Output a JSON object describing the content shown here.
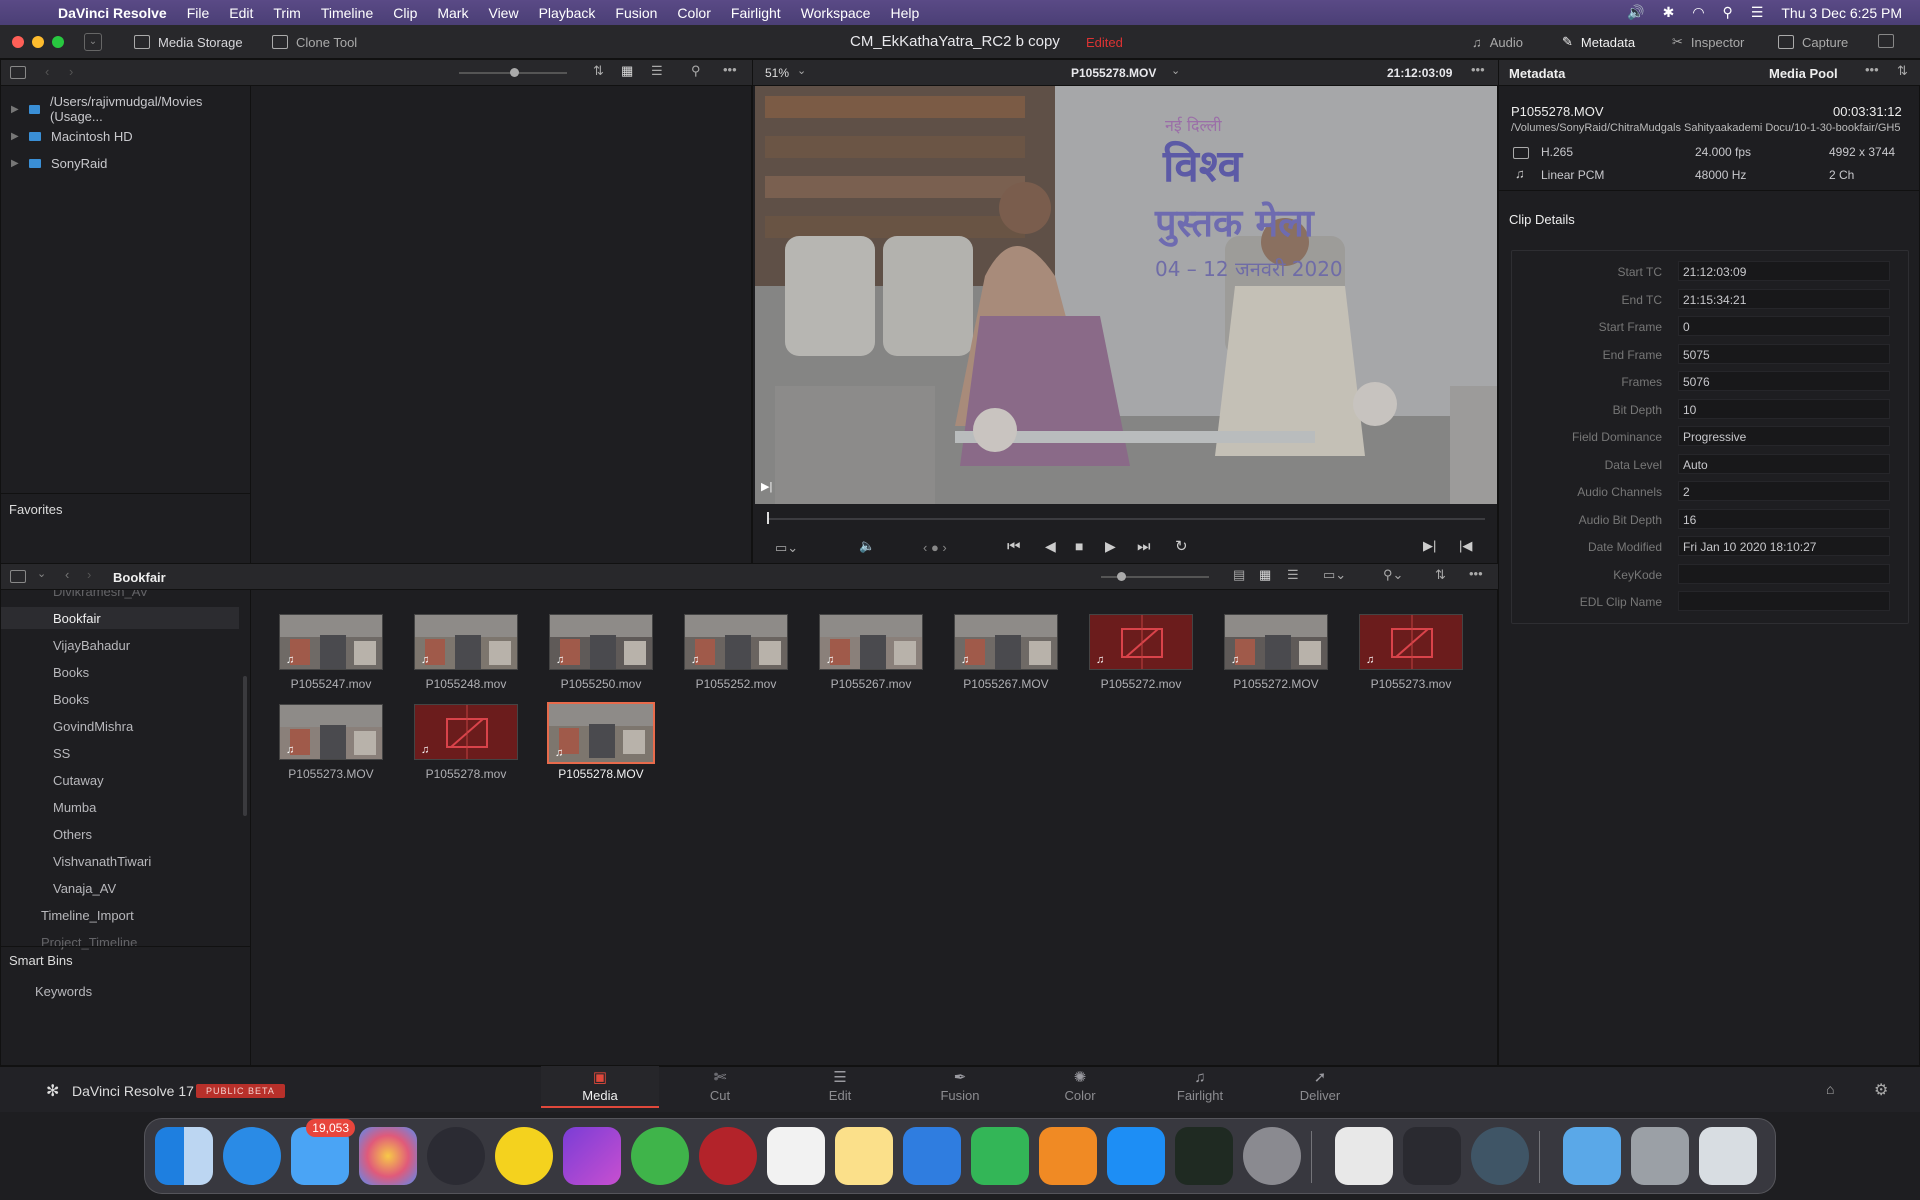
{
  "menubar": {
    "app_name": "DaVinci Resolve",
    "items": [
      "File",
      "Edit",
      "Trim",
      "Timeline",
      "Clip",
      "Mark",
      "View",
      "Playback",
      "Fusion",
      "Color",
      "Fairlight",
      "Workspace",
      "Help"
    ],
    "clock": "Thu 3 Dec  6:25 PM"
  },
  "titlebar": {
    "media_storage": "Media Storage",
    "clone_tool": "Clone Tool",
    "project_title": "CM_EkKathaYatra_RC2 b copy",
    "edited": "Edited",
    "audio": "Audio",
    "metadata": "Metadata",
    "inspector": "Inspector",
    "capture": "Capture"
  },
  "storage": {
    "locations": [
      "/Users/rajivmudgal/Movies (Usage...",
      "Macintosh HD",
      "SonyRaid"
    ],
    "favorites": "Favorites"
  },
  "viewer": {
    "zoom": "51%",
    "clip_name": "P1055278.MOV",
    "timecode": "21:12:03:09",
    "sign_top": "नई दिल्ली",
    "sign_line1": "विश्व",
    "sign_line2": "पुस्तक मेला",
    "sign_dates": "04 – 12 जनवरी 2020"
  },
  "media_pool": {
    "bin_title": "Bookfair",
    "bins": [
      {
        "label": "Divikramesh_AV",
        "indent": 2
      },
      {
        "label": "Bookfair",
        "indent": 2,
        "selected": true
      },
      {
        "label": "VijayBahadur",
        "indent": 2
      },
      {
        "label": "Books",
        "indent": 2
      },
      {
        "label": "Books",
        "indent": 2
      },
      {
        "label": "GovindMishra",
        "indent": 2
      },
      {
        "label": "SS",
        "indent": 2
      },
      {
        "label": "Cutaway",
        "indent": 2
      },
      {
        "label": "Mumba",
        "indent": 2
      },
      {
        "label": "Others",
        "indent": 2
      },
      {
        "label": "VishvanathTiwari",
        "indent": 2
      },
      {
        "label": "Vanaja_AV",
        "indent": 2
      },
      {
        "label": "Timeline_Import",
        "indent": 1
      },
      {
        "label": "Project_Timeline",
        "indent": 1
      }
    ],
    "smart_bins": "Smart Bins",
    "keywords": "Keywords",
    "clips": [
      {
        "name": "P1055247.mov",
        "offline": false
      },
      {
        "name": "P1055248.mov",
        "offline": false
      },
      {
        "name": "P1055250.mov",
        "offline": false
      },
      {
        "name": "P1055252.mov",
        "offline": false
      },
      {
        "name": "P1055267.mov",
        "offline": false
      },
      {
        "name": "P1055267.MOV",
        "offline": false
      },
      {
        "name": "P1055272.mov",
        "offline": true
      },
      {
        "name": "P1055272.MOV",
        "offline": false
      },
      {
        "name": "P1055273.mov",
        "offline": true
      },
      {
        "name": "P1055273.MOV",
        "offline": false
      },
      {
        "name": "P1055278.mov",
        "offline": true
      },
      {
        "name": "P1055278.MOV",
        "offline": false,
        "selected": true
      }
    ]
  },
  "metadata": {
    "header": "Metadata",
    "media_pool": "Media Pool",
    "clip_name": "P1055278.MOV",
    "duration": "00:03:31:12",
    "path": "/Volumes/SonyRaid/ChitraMudgals Sahityaakademi Docu/10-1-30-bookfair/GH5",
    "video_codec": "H.265",
    "fps": "24.000 fps",
    "resolution": "4992 x 3744",
    "audio_codec": "Linear PCM",
    "sample_rate": "48000 Hz",
    "channels": "2 Ch",
    "clip_details": "Clip Details",
    "fields": [
      {
        "key": "Start TC",
        "value": "21:12:03:09"
      },
      {
        "key": "End TC",
        "value": "21:15:34:21"
      },
      {
        "key": "Start Frame",
        "value": "0"
      },
      {
        "key": "End Frame",
        "value": "5075"
      },
      {
        "key": "Frames",
        "value": "5076"
      },
      {
        "key": "Bit Depth",
        "value": "10"
      },
      {
        "key": "Field Dominance",
        "value": "Progressive"
      },
      {
        "key": "Data Level",
        "value": "Auto"
      },
      {
        "key": "Audio Channels",
        "value": "2"
      },
      {
        "key": "Audio Bit Depth",
        "value": "16"
      },
      {
        "key": "Date Modified",
        "value": "Fri Jan 10 2020 18:10:27"
      },
      {
        "key": "KeyKode",
        "value": ""
      },
      {
        "key": "EDL Clip Name",
        "value": ""
      }
    ]
  },
  "footer": {
    "app_label": "DaVinci Resolve 17",
    "beta_badge": "PUBLIC BETA",
    "pages": [
      "Media",
      "Cut",
      "Edit",
      "Fusion",
      "Color",
      "Fairlight",
      "Deliver"
    ],
    "active_page": "Media"
  },
  "dock": {
    "mail_badge": "19,053"
  },
  "colors": {
    "accent": "#e0483b",
    "selection": "#e86b4c",
    "offline": "#6b1c1c",
    "beta_badge": "#b8302a"
  }
}
